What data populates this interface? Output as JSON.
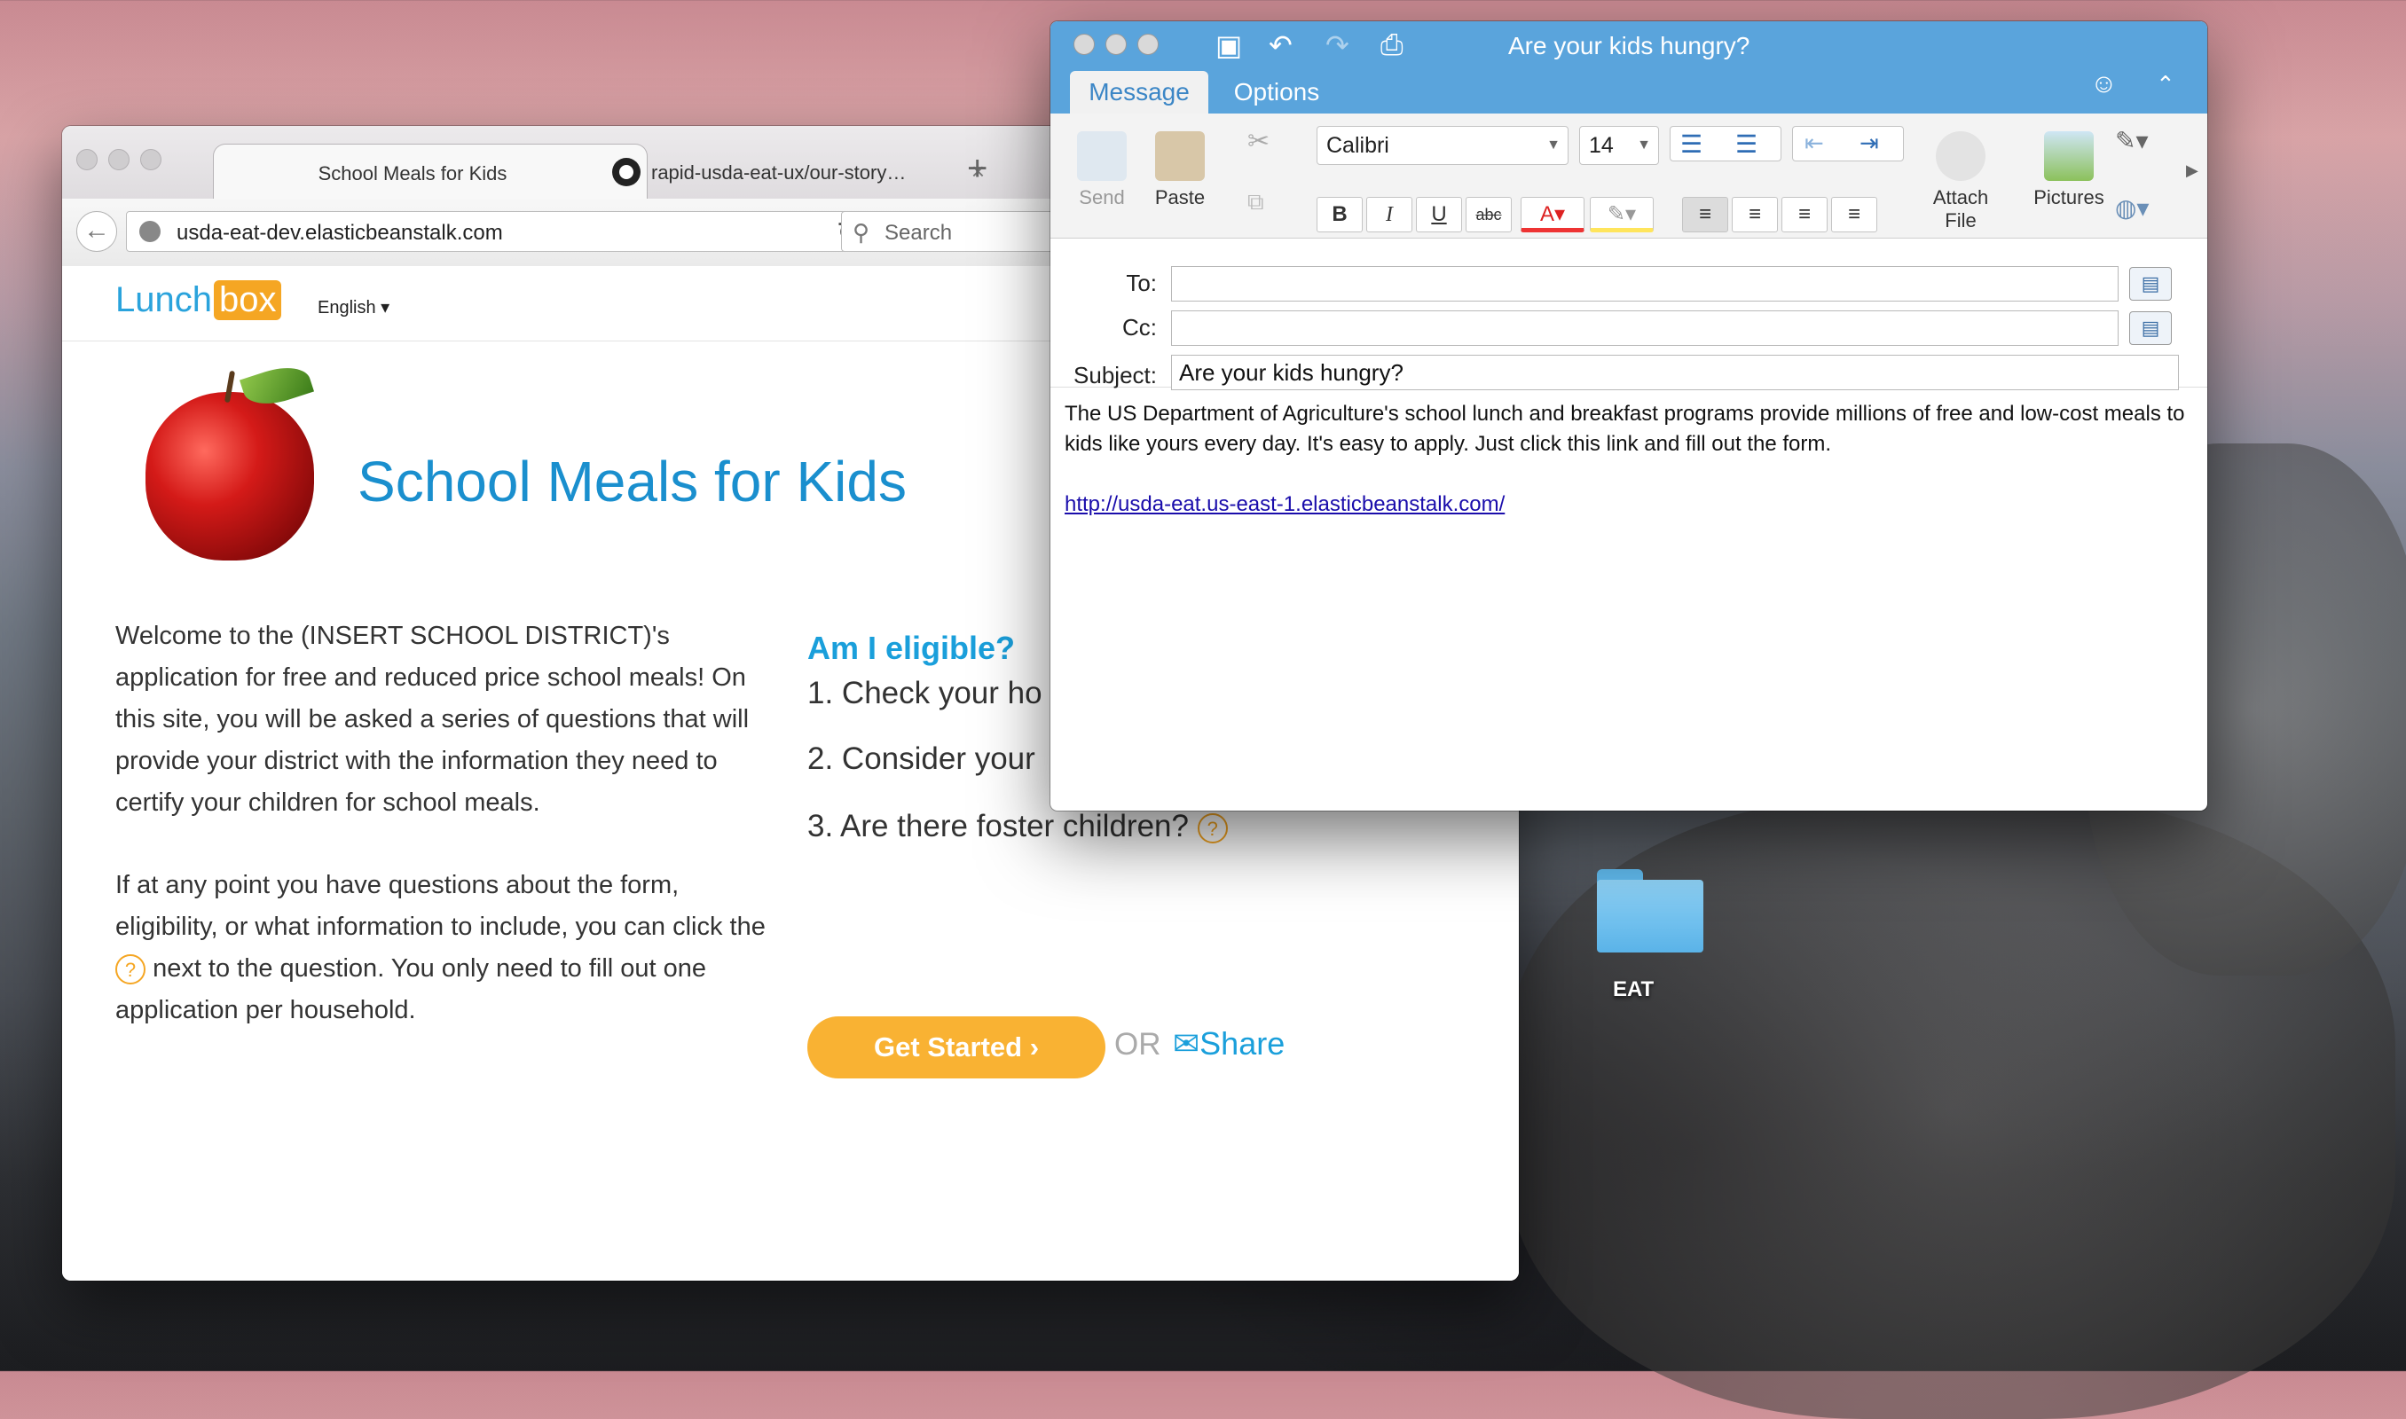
{
  "browser": {
    "tabs": [
      {
        "label": "School Meals for Kids",
        "active": true
      },
      {
        "label": "rapid-usda-eat-ux/our-story…",
        "active": false
      }
    ],
    "url": "usda-eat-dev.elasticbeanstalk.com",
    "search_placeholder": "Search"
  },
  "site": {
    "logo_part1": "Lunch",
    "logo_part2": "box",
    "language": "English ▾",
    "title": "School Meals for Kids",
    "intro_p1": "Welcome to the (INSERT SCHOOL DISTRICT)'s application for free and reduced price school meals! On this site, you will be asked a series of questions that will provide your district with the information they need to certify your children for school meals.",
    "intro_p2_a": "If at any point you have questions about the form, eligibility, or what information to include, you can click the",
    "intro_p2_b": "next to the question. You only need to fill out one application per household.",
    "help_glyph": "?",
    "eligible_heading": "Am I eligible?",
    "steps": [
      "1. Check your ho",
      "2. Consider your",
      "3. Are there foster children?"
    ],
    "get_started": "Get Started  ›",
    "or": "OR",
    "share": "✉Share"
  },
  "mail": {
    "window_title": "Are your kids hungry?",
    "tabs": [
      "Message",
      "Options"
    ],
    "ribbon": {
      "send": "Send",
      "paste": "Paste",
      "font": "Calibri",
      "size": "14",
      "attach": "Attach\nFile",
      "pictures": "Pictures"
    },
    "to_label": "To:",
    "cc_label": "Cc:",
    "subject_label": "Subject:",
    "to_value": "",
    "cc_value": "",
    "subject_value": "Are your kids hungry?",
    "body_text": "The US Department of Agriculture's school lunch and breakfast programs provide millions of free and low-cost meals to kids like yours every day. It's easy to apply. Just click this link and fill out the form.",
    "body_link": "http://usda-eat.us-east-1.elasticbeanstalk.com/"
  },
  "desktop": {
    "folder_label": "EAT"
  },
  "colors": {
    "brand_blue": "#1a8fce",
    "accent_orange": "#f9b233",
    "outlook_blue": "#5aa4dc"
  }
}
